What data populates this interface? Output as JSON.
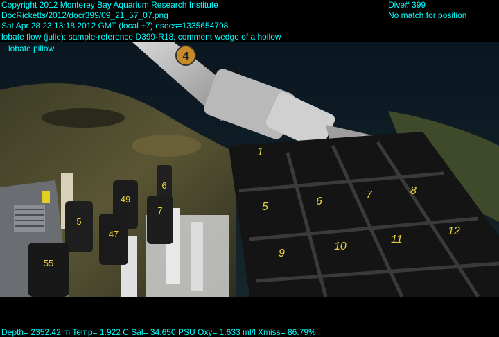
{
  "overlay": {
    "line1": "Copyright 2012 Monterey Bay Aquarium Research Institute",
    "line2": "DocRicketts/2012/docr399/09_21_57_07.png",
    "line3": "Sat Apr 28 23:13:18 2012 GMT (local +7)  esecs=1335654798",
    "line4": "lobate flow (julie): sample-reference D399-R18, comment wedge of a hollow",
    "line5": "lobate pillow",
    "dive": "Dive# 399",
    "position": "No match for position",
    "sensors": "Depth= 2352.42 m  Temp= 1.922 C  Sal= 34.650 PSU  Oxy= 1.633 ml/l  Xmiss= 86.79%"
  },
  "scene": {
    "arm_label": "4",
    "bottle_labels": [
      "6",
      "49",
      "5",
      "47",
      "7",
      "55"
    ],
    "quiver_numbers": [
      "1",
      "5",
      "6",
      "7",
      "8",
      "9",
      "10",
      "11",
      "12"
    ]
  },
  "colors": {
    "overlay_text": "#00ffff",
    "water": "#0d1a24",
    "seafloor": "#4a4a2a",
    "quiver": "#151515",
    "quiver_numbers": "#e8d23a"
  }
}
